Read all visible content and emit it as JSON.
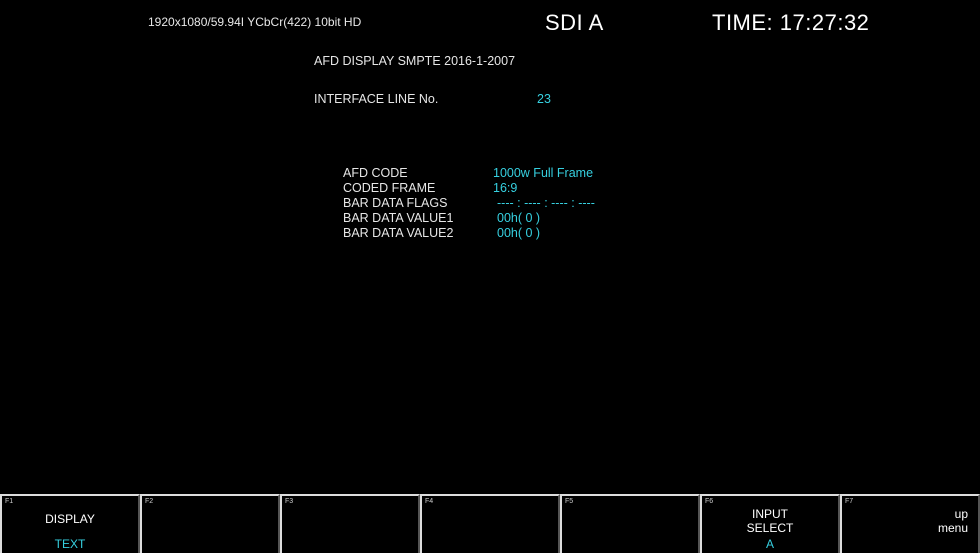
{
  "header": {
    "format": "1920x1080/59.94I YCbCr(422) 10bit HD",
    "input": "SDI A",
    "time": "TIME: 17:27:32"
  },
  "afd": {
    "title": "AFD DISPLAY SMPTE 2016-1-2007",
    "interface_line_label": "INTERFACE LINE No.",
    "interface_line_value": "23",
    "rows": [
      {
        "label": "AFD CODE",
        "value": "1000w Full Frame"
      },
      {
        "label": "CODED FRAME",
        "value": "16:9"
      },
      {
        "label": "BAR DATA FLAGS",
        "value": "---- : ---- : ---- : ----"
      },
      {
        "label": "BAR DATA VALUE1",
        "value": "00h( 0 )"
      },
      {
        "label": "BAR DATA VALUE2",
        "value": "00h( 0 )"
      }
    ]
  },
  "fkeys": [
    {
      "num": "F1",
      "line1": "DISPLAY",
      "line2": "",
      "selected": "TEXT"
    },
    {
      "num": "F2",
      "line1": "",
      "line2": "",
      "selected": ""
    },
    {
      "num": "F3",
      "line1": "",
      "line2": "",
      "selected": ""
    },
    {
      "num": "F4",
      "line1": "",
      "line2": "",
      "selected": ""
    },
    {
      "num": "F5",
      "line1": "",
      "line2": "",
      "selected": ""
    },
    {
      "num": "F6",
      "line1": "INPUT",
      "line2": "SELECT",
      "selected": "A"
    },
    {
      "num": "F7",
      "line1": "up",
      "line2": "menu",
      "selected": ""
    }
  ],
  "colors": {
    "background": "#000000",
    "value_cyan": "#36d0e0",
    "text": "#ffffff"
  }
}
